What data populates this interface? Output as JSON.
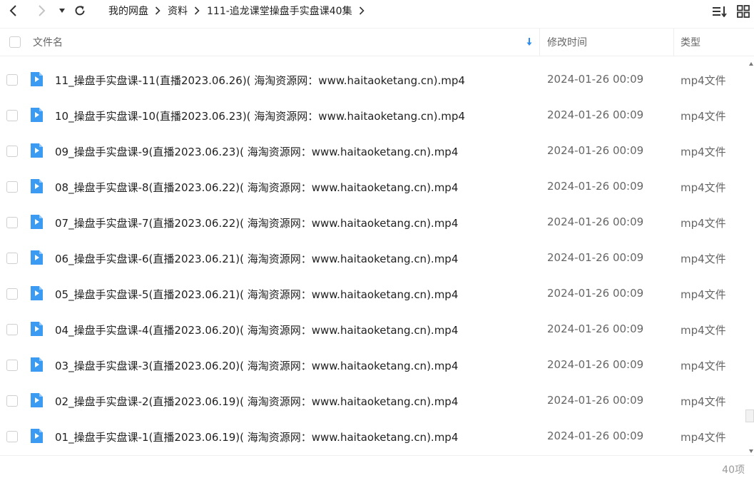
{
  "breadcrumb": {
    "items": [
      "我的网盘",
      "资料",
      "111-追龙课堂操盘手实盘课40集"
    ]
  },
  "header": {
    "name_col": "文件名",
    "time_col": "修改时间",
    "type_col": "类型"
  },
  "files": [
    {
      "name": "11_操盘手实盘课-11(直播2023.06.26)( 海淘资源网：www.haitaoketang.cn).mp4",
      "time": "2024-01-26 00:09",
      "type": "mp4文件"
    },
    {
      "name": "10_操盘手实盘课-10(直播2023.06.23)( 海淘资源网：www.haitaoketang.cn).mp4",
      "time": "2024-01-26 00:09",
      "type": "mp4文件"
    },
    {
      "name": "09_操盘手实盘课-9(直播2023.06.23)( 海淘资源网：www.haitaoketang.cn).mp4",
      "time": "2024-01-26 00:09",
      "type": "mp4文件"
    },
    {
      "name": "08_操盘手实盘课-8(直播2023.06.22)( 海淘资源网：www.haitaoketang.cn).mp4",
      "time": "2024-01-26 00:09",
      "type": "mp4文件"
    },
    {
      "name": "07_操盘手实盘课-7(直播2023.06.22)( 海淘资源网：www.haitaoketang.cn).mp4",
      "time": "2024-01-26 00:09",
      "type": "mp4文件"
    },
    {
      "name": "06_操盘手实盘课-6(直播2023.06.21)( 海淘资源网：www.haitaoketang.cn).mp4",
      "time": "2024-01-26 00:09",
      "type": "mp4文件"
    },
    {
      "name": "05_操盘手实盘课-5(直播2023.06.21)( 海淘资源网：www.haitaoketang.cn).mp4",
      "time": "2024-01-26 00:09",
      "type": "mp4文件"
    },
    {
      "name": "04_操盘手实盘课-4(直播2023.06.20)( 海淘资源网：www.haitaoketang.cn).mp4",
      "time": "2024-01-26 00:09",
      "type": "mp4文件"
    },
    {
      "name": "03_操盘手实盘课-3(直播2023.06.20)( 海淘资源网：www.haitaoketang.cn).mp4",
      "time": "2024-01-26 00:09",
      "type": "mp4文件"
    },
    {
      "name": "02_操盘手实盘课-2(直播2023.06.19)( 海淘资源网：www.haitaoketang.cn).mp4",
      "time": "2024-01-26 00:09",
      "type": "mp4文件"
    },
    {
      "name": "01_操盘手实盘课-1(直播2023.06.19)( 海淘资源网：www.haitaoketang.cn).mp4",
      "time": "2024-01-26 00:09",
      "type": "mp4文件"
    }
  ],
  "footer": {
    "count": "40项"
  },
  "colors": {
    "file_icon": "#3b9bf2",
    "sort_arrow": "#2d8cf0"
  }
}
